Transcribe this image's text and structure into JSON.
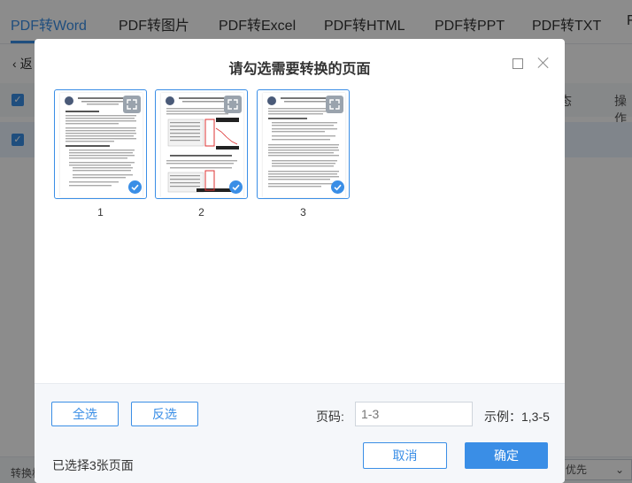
{
  "tabs": [
    {
      "label": "PDF转Word",
      "active": true
    },
    {
      "label": "PDF转图片",
      "active": false
    },
    {
      "label": "PDF转Excel",
      "active": false
    },
    {
      "label": "PDF转HTML",
      "active": false
    },
    {
      "label": "PDF转PPT",
      "active": false
    },
    {
      "label": "PDF转TXT",
      "active": false
    },
    {
      "label": "F",
      "active": false
    }
  ],
  "background": {
    "back_label": "返",
    "header_status": "态",
    "header_action": "操作",
    "bottom_left_label": "转换格",
    "bottom_select_value": "优先"
  },
  "modal": {
    "title": "请勾选需要转换的页面",
    "pages": [
      {
        "number": "1",
        "selected": true
      },
      {
        "number": "2",
        "selected": true
      },
      {
        "number": "3",
        "selected": true
      }
    ],
    "footer": {
      "select_all_label": "全选",
      "invert_label": "反选",
      "page_range_label": "页码:",
      "page_range_value": "1-3",
      "example_label": "示例：1,3-5",
      "selected_summary": "已选择3张页面",
      "cancel_label": "取消",
      "confirm_label": "确定"
    }
  },
  "colors": {
    "accent": "#3a8ee6",
    "overlay": "rgba(0,0,0,0.45)"
  }
}
